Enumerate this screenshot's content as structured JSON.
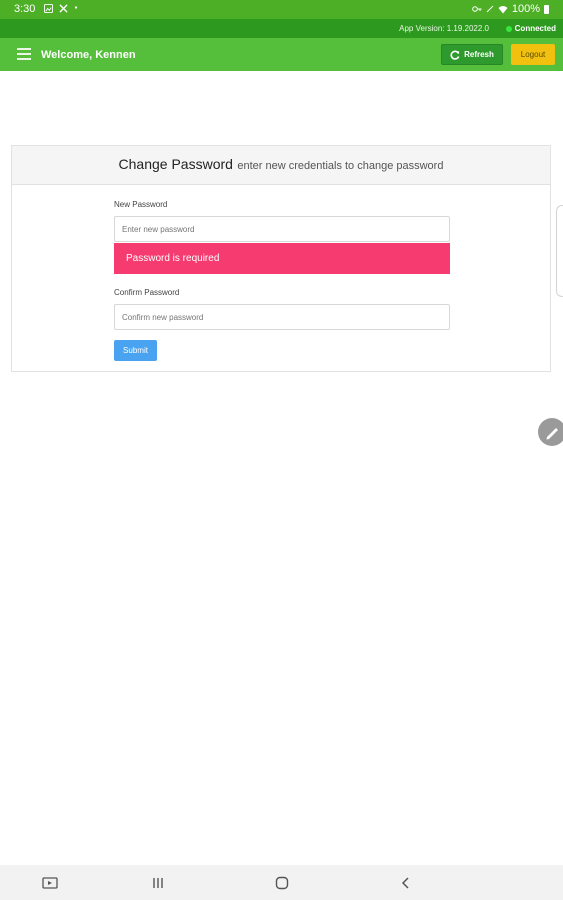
{
  "status_bar": {
    "time": "3:30",
    "battery": "100%",
    "icons": [
      "notification-dot-icon",
      "gallery-icon",
      "tools-icon",
      "dot-icon",
      "key-icon",
      "mute-icon",
      "wifi-icon",
      "battery-icon"
    ]
  },
  "version_bar": {
    "version": "App Version: 1.19.2022.0",
    "connection": "Connected",
    "connection_color": "#39e640"
  },
  "header": {
    "welcome": "Welcome, Kennen",
    "refresh_label": "Refresh",
    "logout_label": "Logout",
    "colors": {
      "bar": "#55bf3b",
      "refresh": "#2e9a2e",
      "logout": "#f2c10f"
    }
  },
  "form": {
    "title": "Change Password",
    "subtitle": "enter new credentials to change password",
    "new_password_label": "New Password",
    "new_password_placeholder": "Enter new password",
    "new_password_value": "",
    "error": "Password is required",
    "confirm_password_label": "Confirm Password",
    "confirm_password_placeholder": "Confirm new password",
    "confirm_password_value": "",
    "submit_label": "Submit",
    "colors": {
      "error": "#f53b6f",
      "submit": "#4aa3f0"
    }
  },
  "nav_bar": {
    "icons": [
      "screenshot-icon",
      "recent-apps-icon",
      "home-icon",
      "back-icon"
    ]
  }
}
